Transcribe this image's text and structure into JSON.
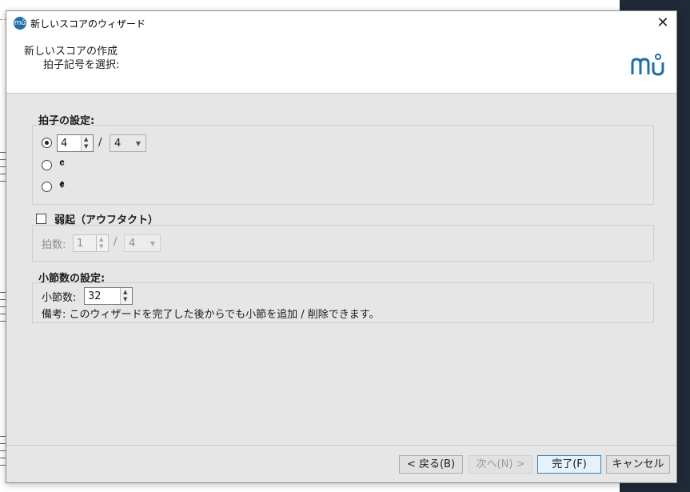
{
  "window": {
    "title": "新しいスコアのウィザード",
    "app_icon_glyph": "mů",
    "close_glyph": "✕"
  },
  "header": {
    "title": "新しいスコアの作成",
    "subtitle": "拍子記号を選択:",
    "accent_color": "#1f6fa8"
  },
  "time_signature": {
    "section_title": "拍子の設定:",
    "numerator": "4",
    "separator": "/",
    "denominator": "4",
    "common_time_symbol": "𝄴",
    "cut_time_symbol": "𝄵",
    "selected_option": "numeric"
  },
  "pickup": {
    "label": "弱起（アウフタクト）",
    "checked": false,
    "beats_label": "拍数:",
    "beats_value": "1",
    "separator": "/",
    "denominator": "4"
  },
  "measures": {
    "section_title": "小節数の設定:",
    "count_label": "小節数:",
    "count_value": "32",
    "note": "備考: このウィザードを完了した後からでも小節を追加 / 削除できます。"
  },
  "buttons": {
    "back": "< 戻る(B)",
    "next": "次へ(N) >",
    "finish": "完了(F)",
    "cancel": "キャンセル"
  }
}
